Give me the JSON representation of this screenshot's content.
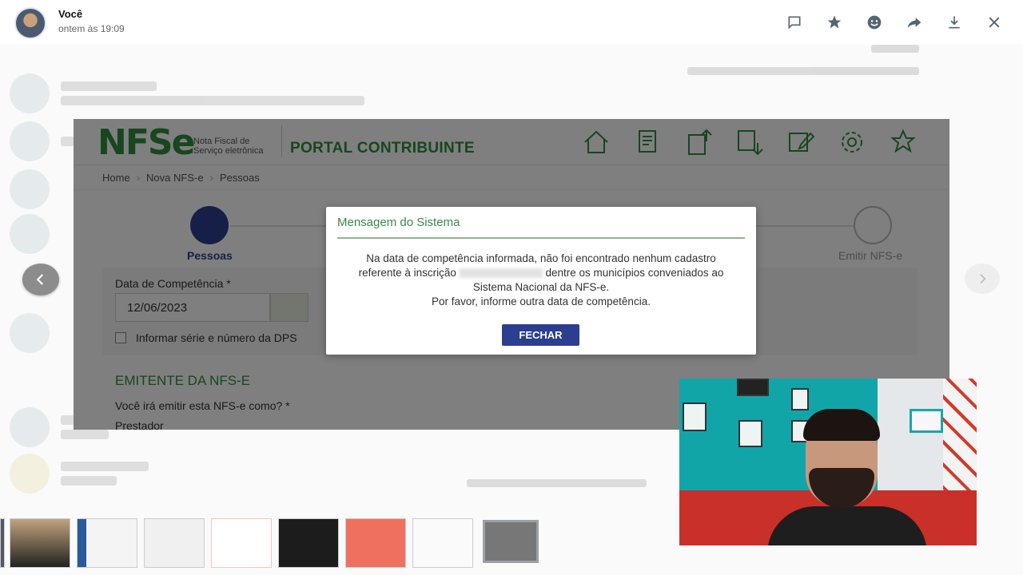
{
  "header": {
    "sender_name": "Você",
    "timestamp": "ontem às 19:09",
    "actions": [
      {
        "name": "reply-icon"
      },
      {
        "name": "star-icon"
      },
      {
        "name": "emoji-icon"
      },
      {
        "name": "forward-icon"
      },
      {
        "name": "download-icon"
      },
      {
        "name": "close-icon"
      }
    ]
  },
  "portal": {
    "logo_text": "NFSe",
    "logo_subtitle": "Nota Fiscal de Serviço eletrônica",
    "title": "PORTAL CONTRIBUINTE",
    "breadcrumb": [
      "Home",
      "Nova NFS-e",
      "Pessoas"
    ],
    "step_active": "Pessoas",
    "step_last": "Emitir NFS-e",
    "date_label": "Data de Competência *",
    "date_value": "12/06/2023",
    "checkbox_label": "Informar série e número da DPS",
    "section_title": "EMITENTE DA NFS-E",
    "section_question": "Você irá emitir esta NFS-e como? *",
    "radio_option": "Prestador"
  },
  "modal": {
    "title": "Mensagem do Sistema",
    "line1": "Na data de competência informada, não foi encontrado nenhum cadastro",
    "line2_pre": "referente à inscrição",
    "line2_post": "dentre os municípios conveniados ao",
    "line3": "Sistema Nacional da NFS-e.",
    "line4": "Por favor, informe outra data de competência.",
    "button": "FECHAR"
  },
  "colors": {
    "brand_green": "#2e8c3e",
    "brand_blue": "#2c3e8f"
  }
}
